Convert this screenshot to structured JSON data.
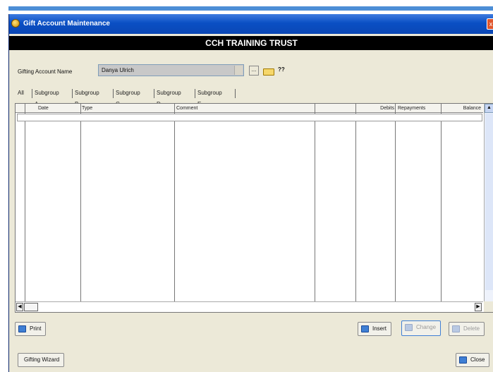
{
  "window": {
    "title": "Gift Account Maintenance",
    "close_label": "x",
    "company": "CCH TRAINING TRUST"
  },
  "account": {
    "label": "Gifting Account Name",
    "value": "Danya Ulrich",
    "ellipsis": "...",
    "flag": "??"
  },
  "tabs": [
    "All",
    "Subgroup A",
    "Subgroup B",
    "Subgroup C",
    "Subgroup D",
    "Subgroup E"
  ],
  "grid": {
    "columns": [
      "Date",
      "Type",
      "Comment",
      "",
      "Debits",
      "Repayments",
      "Balance"
    ],
    "rows": []
  },
  "buttons": {
    "print": "Print",
    "insert": "Insert",
    "change": "Change",
    "delete": "Delete",
    "wizard": "Gifting Wizard",
    "close": "Close"
  },
  "colors": {
    "titlebar": "#0a4fc4",
    "banner": "#000000",
    "window_bg": "#ece9d8"
  }
}
